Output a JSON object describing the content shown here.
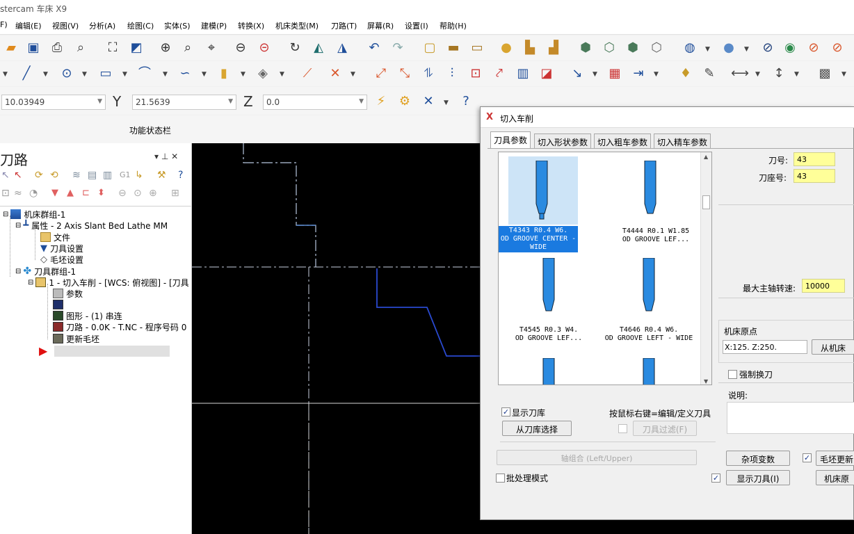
{
  "app": {
    "title": "stercam 车床 X9"
  },
  "menu": [
    "F)",
    "编辑(E)",
    "视图(V)",
    "分析(A)",
    "绘图(C)",
    "实体(S)",
    "建模(P)",
    "转换(X)",
    "机床类型(M)",
    "刀路(T)",
    "屏幕(R)",
    "设置(I)",
    "帮助(H)"
  ],
  "coords": {
    "x_value": "10.03949",
    "y_label": "Y",
    "y_value": "21.5639",
    "z_label": "Z",
    "z_value": "0.0"
  },
  "status_bar_label": "功能状态栏",
  "toolpath_panel": {
    "title": "刀路",
    "pin": "▾ ⊥ ✕",
    "tree": [
      {
        "label": "机床群组-1"
      },
      {
        "label": "属性 - 2 Axis Slant Bed Lathe MM"
      },
      {
        "label": "文件"
      },
      {
        "label": "刀具设置"
      },
      {
        "label": "毛坯设置"
      },
      {
        "label": "刀具群组-1"
      },
      {
        "label": "1 - 切入车削 - [WCS: 俯视图] - [刀具"
      },
      {
        "label": "参数"
      },
      {
        "label": "图形 - (1) 串连"
      },
      {
        "label": "刀路 - 0.0K - T.NC - 程序号码 0"
      },
      {
        "label": "更新毛坯"
      }
    ]
  },
  "dialog": {
    "title": "切入车削",
    "tabs": [
      "刀具参数",
      "切入形状参数",
      "切入粗车参数",
      "切入精车参数"
    ],
    "tools": [
      {
        "label": "T4343 R0.4 W6.\nOD GROOVE CENTER -\nWIDE"
      },
      {
        "label": "T4444 R0.1 W1.85\nOD GROOVE LEF..."
      },
      {
        "label": "T4545 R0.3 W4.\nOD GROOVE LEF..."
      },
      {
        "label": "T4646 R0.4 W6.\nOD GROOVE LEFT - WIDE"
      }
    ],
    "tool_number_label": "刀号:",
    "tool_number": "43",
    "turret_label": "刀座号:",
    "turret_number": "43",
    "max_spindle_label": "最大主轴转速:",
    "max_spindle": "10000",
    "home_label": "机床原点",
    "home_value": "X:125.   Z:250.",
    "from_machine_btn": "从机床",
    "force_change_label": "强制换刀",
    "comment_label": "说明:",
    "show_library_label": "显示刀库",
    "select_library_btn": "从刀库选择",
    "right_click_hint": "按鼠标右键=编辑/定义刀具",
    "tool_filter_btn": "刀具过滤(F)",
    "axis_combo_btn": "轴组合 (Left/Upper)",
    "misc_values_btn": "杂项变数",
    "stock_update_btn": "毛坯更新",
    "batch_mode_label": "批处理模式",
    "show_tool_btn": "显示刀具(I)",
    "machine_home_btn": "机床原"
  }
}
